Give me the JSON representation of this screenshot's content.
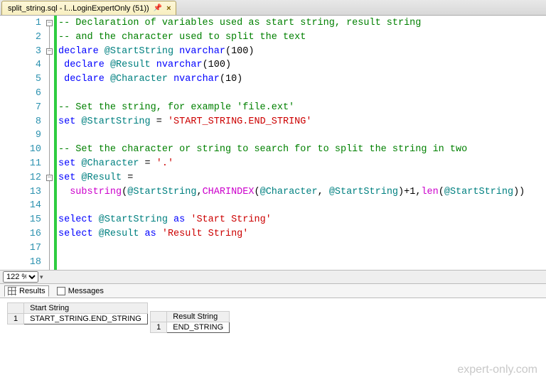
{
  "tab": {
    "title": "split_string.sql - l...LoginExpertOnly (51))"
  },
  "editor": {
    "lines": [
      {
        "n": 1,
        "cls": "cmt",
        "pad": 0,
        "text": "-- Declaration of variables used as start string, result string"
      },
      {
        "n": 2,
        "cls": "cmt",
        "pad": 0,
        "text": "-- and the character used to split the text"
      },
      {
        "n": 3,
        "cls": "",
        "pad": 0,
        "html": "<span class='kw'>declare</span> <span class='sys'>@StartString</span> <span class='kw'>nvarchar</span>(100)"
      },
      {
        "n": 4,
        "cls": "",
        "pad": 1,
        "html": "<span class='kw'>declare</span> <span class='sys'>@Result</span> <span class='kw'>nvarchar</span>(100)"
      },
      {
        "n": 5,
        "cls": "",
        "pad": 1,
        "html": "<span class='kw'>declare</span> <span class='sys'>@Character</span> <span class='kw'>nvarchar</span>(10)"
      },
      {
        "n": 6,
        "cls": "",
        "pad": 0,
        "text": ""
      },
      {
        "n": 7,
        "cls": "cmt",
        "pad": 0,
        "text": "-- Set the string, for example 'file.ext'"
      },
      {
        "n": 8,
        "cls": "",
        "pad": 0,
        "html": "<span class='kw'>set</span> <span class='sys'>@StartString</span> = <span class='str'>'START_STRING.END_STRING'</span>"
      },
      {
        "n": 9,
        "cls": "",
        "pad": 0,
        "text": ""
      },
      {
        "n": 10,
        "cls": "cmt",
        "pad": 0,
        "text": "-- Set the character or string to search for to split the string in two"
      },
      {
        "n": 11,
        "cls": "",
        "pad": 0,
        "html": "<span class='kw'>set</span> <span class='sys'>@Character</span> = <span class='str'>'.'</span>"
      },
      {
        "n": 12,
        "cls": "",
        "pad": 0,
        "html": "<span class='kw'>set</span> <span class='sys'>@Result</span> ="
      },
      {
        "n": 13,
        "cls": "",
        "pad": 2,
        "html": "<span class='fn'>substring</span>(<span class='sys'>@StartString</span>,<span class='fn'>CHARINDEX</span>(<span class='sys'>@Character</span>, <span class='sys'>@StartString</span>)+1,<span class='fn'>len</span>(<span class='sys'>@StartString</span>))"
      },
      {
        "n": 14,
        "cls": "",
        "pad": 0,
        "text": ""
      },
      {
        "n": 15,
        "cls": "",
        "pad": 0,
        "html": "<span class='kw'>select</span> <span class='sys'>@StartString</span> <span class='kw'>as</span> <span class='str'>'Start String'</span>"
      },
      {
        "n": 16,
        "cls": "",
        "pad": 0,
        "html": "<span class='kw'>select</span> <span class='sys'>@Result</span> <span class='kw'>as</span> <span class='str'>'Result String'</span>"
      },
      {
        "n": 17,
        "cls": "",
        "pad": 0,
        "text": ""
      },
      {
        "n": 18,
        "cls": "",
        "pad": 0,
        "text": ""
      }
    ],
    "fold_marks": [
      1,
      3,
      12
    ]
  },
  "zoom": {
    "value": "122 %"
  },
  "results_tabs": {
    "results": "Results",
    "messages": "Messages"
  },
  "results": {
    "grids": [
      {
        "header": "Start String",
        "rownum": "1",
        "value": "START_STRING.END_STRING"
      },
      {
        "header": "Result String",
        "rownum": "1",
        "value": "END_STRING"
      }
    ]
  },
  "watermark": "expert-only.com"
}
